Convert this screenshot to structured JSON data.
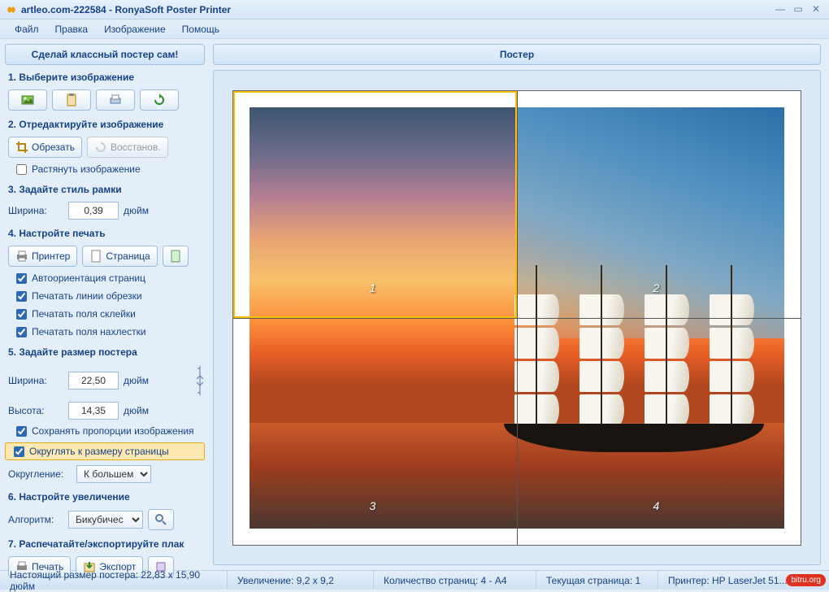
{
  "title": "artleo.com-222584 - RonyaSoft Poster Printer",
  "menu": {
    "file": "Файл",
    "edit": "Правка",
    "image": "Изображение",
    "help": "Помощь"
  },
  "sidebar": {
    "header": "Сделай классный постер сам!",
    "step1": "1. Выберите изображение",
    "step2": "2. Отредактируйте изображение",
    "crop": "Обрезать",
    "restore": "Восстанов.",
    "stretch": "Растянуть изображение",
    "step3": "3. Задайте стиль рамки",
    "width_lbl": "Ширина:",
    "frame_width": "0,39",
    "unit": "дюйм",
    "step4": "4. Настройте печать",
    "printer": "Принтер",
    "page": "Страница",
    "auto_orient": "Автоориентация страниц",
    "crop_lines": "Печатать линии обрезки",
    "glue_fields": "Печатать поля склейки",
    "overlap_fields": "Печатать поля нахлестки",
    "step5": "5. Задайте размер постера",
    "size_w": "22,50",
    "height_lbl": "Высота:",
    "size_h": "14,35",
    "keep_ratio": "Сохранять пропорции изображения",
    "round_page": "Округлять к размеру страницы",
    "round_lbl": "Округление:",
    "round_val": "К большем",
    "step6": "6. Настройте увеличение",
    "algo_lbl": "Алгоритм:",
    "algo_val": "Бикубичес",
    "step7": "7. Распечатайте/экспортируйте плак",
    "print": "Печать",
    "export": "Экспорт"
  },
  "preview": {
    "header": "Постер",
    "p1": "1",
    "p2": "2",
    "p3": "3",
    "p4": "4"
  },
  "status": {
    "size": "Настоящий размер постера: 22,83 x 15,90 дюйм",
    "zoom": "Увеличение: 9,2 x 9,2",
    "pages": "Количество страниц: 4 - A4",
    "cur": "Текущая страница: 1",
    "printer": "Принтер: HP LaserJet 51..."
  },
  "watermark": "bitru.org"
}
